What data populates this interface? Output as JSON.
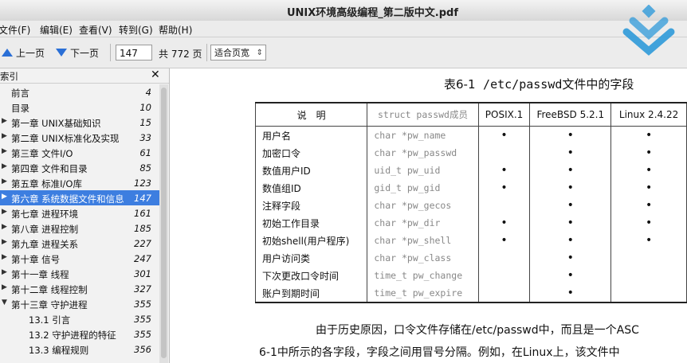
{
  "window": {
    "title": "UNIX环境高级编程_第二版中文.pdf"
  },
  "menu": {
    "items": [
      "文件(F)",
      "编辑(E)",
      "查看(V)",
      "转到(G)",
      "帮助(H)"
    ]
  },
  "toolbar": {
    "prev_label": "上一页",
    "next_label": "下一页",
    "current_page": "147",
    "total_pages": "共 772 页",
    "zoom": "适合页宽"
  },
  "sidebar": {
    "header": "索引",
    "items": [
      {
        "label": "前言",
        "page": "4",
        "expandable": false,
        "indent": 1
      },
      {
        "label": "目录",
        "page": "10",
        "expandable": false,
        "indent": 1
      },
      {
        "label": "第一章 UNIX基础知识",
        "page": "15",
        "expandable": true,
        "indent": 1
      },
      {
        "label": "第二章 UNIX标准化及实现",
        "page": "33",
        "expandable": true,
        "indent": 1
      },
      {
        "label": "第三章 文件I/O",
        "page": "61",
        "expandable": true,
        "indent": 1
      },
      {
        "label": "第四章 文件和目录",
        "page": "85",
        "expandable": true,
        "indent": 1
      },
      {
        "label": "第五章 标准I/O库",
        "page": "123",
        "expandable": true,
        "indent": 1
      },
      {
        "label": "第六章 系统数据文件和信息",
        "page": "147",
        "expandable": true,
        "indent": 1,
        "selected": true
      },
      {
        "label": "第七章 进程环境",
        "page": "161",
        "expandable": true,
        "indent": 1
      },
      {
        "label": "第八章 进程控制",
        "page": "185",
        "expandable": true,
        "indent": 1
      },
      {
        "label": "第九章 进程关系",
        "page": "227",
        "expandable": true,
        "indent": 1
      },
      {
        "label": "第十章 信号",
        "page": "247",
        "expandable": true,
        "indent": 1
      },
      {
        "label": "第十一章 线程",
        "page": "301",
        "expandable": true,
        "indent": 1
      },
      {
        "label": "第十二章 线程控制",
        "page": "327",
        "expandable": true,
        "indent": 1
      },
      {
        "label": "第十三章 守护进程",
        "page": "355",
        "expandable": true,
        "expanded": true,
        "indent": 1
      },
      {
        "label": "13.1 引言",
        "page": "355",
        "expandable": false,
        "indent": 2
      },
      {
        "label": "13.2 守护进程的特征",
        "page": "355",
        "expandable": false,
        "indent": 2
      },
      {
        "label": "13.3 编程规则",
        "page": "356",
        "expandable": false,
        "indent": 2
      }
    ]
  },
  "document": {
    "caption_prefix": "表6-1",
    "caption_path": "/etc/passwd",
    "caption_suffix": "文件中的字段",
    "table": {
      "headers": [
        "说　明",
        "struct passwd成员",
        "POSIX.1",
        "FreeBSD 5.2.1",
        "Linux 2.4.22"
      ],
      "rows": [
        {
          "desc": "用户名",
          "member": "char *pw_name",
          "posix": "•",
          "freebsd": "•",
          "linux": "•"
        },
        {
          "desc": "加密口令",
          "member": "char *pw_passwd",
          "posix": "",
          "freebsd": "•",
          "linux": "•"
        },
        {
          "desc": "数值用户ID",
          "member": "uid_t pw_uid",
          "posix": "•",
          "freebsd": "•",
          "linux": "•"
        },
        {
          "desc": "数值组ID",
          "member": "gid_t pw_gid",
          "posix": "•",
          "freebsd": "•",
          "linux": "•"
        },
        {
          "desc": "注释字段",
          "member": "char *pw_gecos",
          "posix": "",
          "freebsd": "•",
          "linux": "•"
        },
        {
          "desc": "初始工作目录",
          "member": "char *pw_dir",
          "posix": "•",
          "freebsd": "•",
          "linux": "•"
        },
        {
          "desc": "初始shell(用户程序)",
          "member": "char *pw_shell",
          "posix": "•",
          "freebsd": "•",
          "linux": "•"
        },
        {
          "desc": "用户访问类",
          "member": "char *pw_class",
          "posix": "",
          "freebsd": "•",
          "linux": ""
        },
        {
          "desc": "下次更改口令时间",
          "member": "time_t pw_change",
          "posix": "",
          "freebsd": "•",
          "linux": ""
        },
        {
          "desc": "账户到期时间",
          "member": "time_t pw_expire",
          "posix": "",
          "freebsd": "•",
          "linux": ""
        }
      ]
    },
    "para_line1": "由于历史原因，口令文件存储在/etc/passwd中，而且是一个ASC",
    "para_line2": "6-1中所示的各字段，字段之间用冒号分隔。例如，在Linux上，该文件中"
  },
  "colors": {
    "selection": "#3d7ee0",
    "arrow": "#2a6fd6",
    "logo": "#2f9ad9"
  }
}
